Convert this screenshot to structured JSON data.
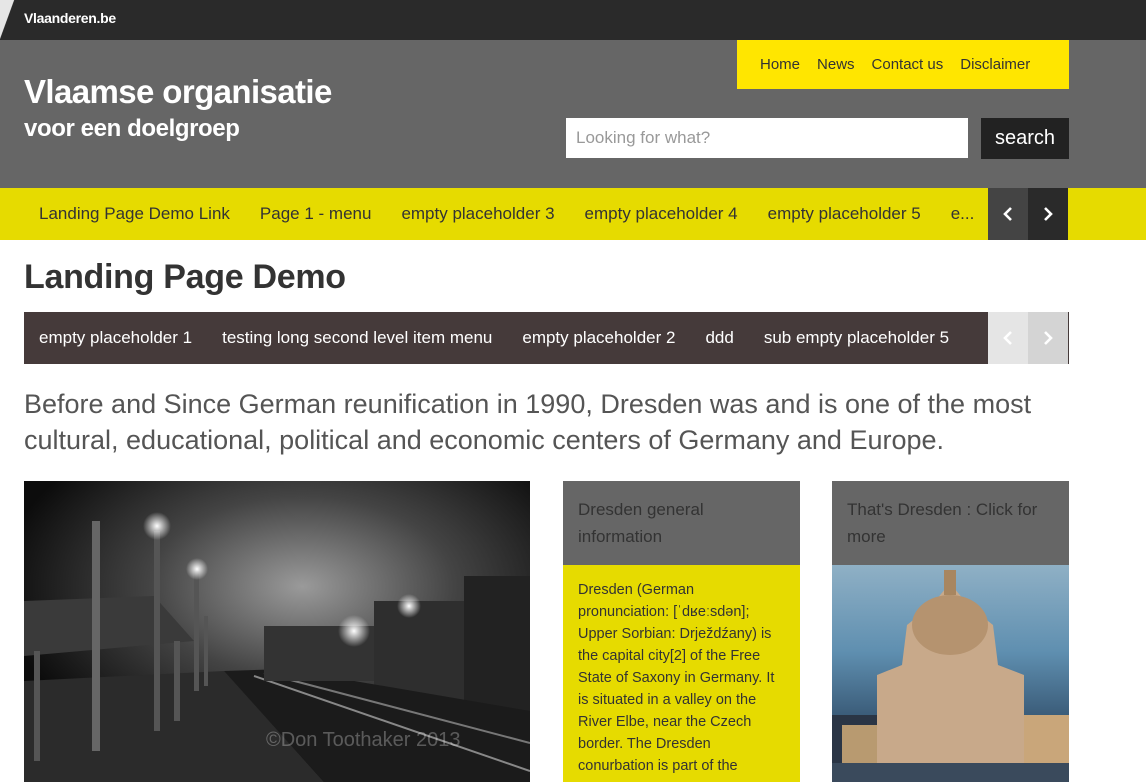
{
  "topbar": {
    "brand": "Vlaanderen.be"
  },
  "header": {
    "title_line1": "Vlaamse organisatie",
    "title_line2": "voor een doelgroep",
    "top_nav": [
      "Home",
      "News",
      "Contact us",
      "Disclaimer"
    ],
    "search": {
      "placeholder": "Looking for what?",
      "button": "search"
    }
  },
  "main_nav": {
    "items": [
      "Landing Page Demo Link",
      "Page 1 - menu",
      "empty placeholder 3",
      "empty placeholder 4",
      "empty placeholder 5",
      "e..."
    ],
    "prev_icon": "chevron-left-icon",
    "next_icon": "chevron-right-icon"
  },
  "page": {
    "title": "Landing Page Demo",
    "sub_nav": [
      "empty placeholder 1",
      "testing long second level item menu",
      "empty placeholder 2",
      "ddd",
      "sub empty placeholder 5"
    ],
    "intro": "Before and Since German reunification in 1990, Dresden was and is one of the most cultural, educational, political and economic centers of Germany and Europe."
  },
  "photo": {
    "watermark": "©Don Toothaker 2013"
  },
  "cards": [
    {
      "title": "Dresden general information",
      "body": "Dresden (German pronunciation: [ˈdʁeːsdən]; Upper Sorbian: Drježdźany) is the capital city[2] of the Free State of Saxony in Germany. It is situated in a valley on the River Elbe, near the Czech border. The Dresden conurbation is part of the"
    },
    {
      "title": "That's Dresden : Click for more"
    }
  ],
  "colors": {
    "yellow": "#ffe600",
    "nav_yellow": "#e6db00",
    "header_grey": "#666666",
    "dark": "#2a2a2a",
    "subnav_brown": "#453a3a"
  }
}
